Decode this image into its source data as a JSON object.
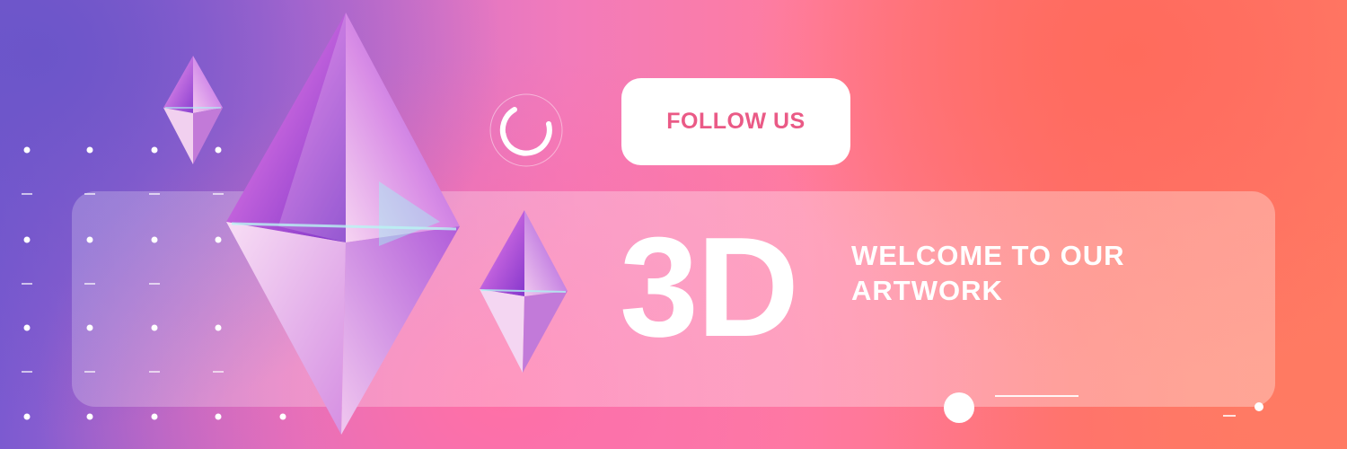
{
  "banner": {
    "follow_button": "FOLLOW US",
    "headline": "3D",
    "tagline_line1": "WELCOME TO OUR",
    "tagline_line2": "ARTWORK",
    "colors": {
      "accent_text": "#ea5a86",
      "gradient_left": "#6b55c9",
      "gradient_mid": "#f27bbb",
      "gradient_right": "#ff6b5c"
    },
    "decor": {
      "gems": [
        "gem-icon",
        "gem-icon",
        "gem-icon"
      ],
      "loader": "loading-ring-icon",
      "carousel_indicator": "carousel-indicator"
    }
  }
}
